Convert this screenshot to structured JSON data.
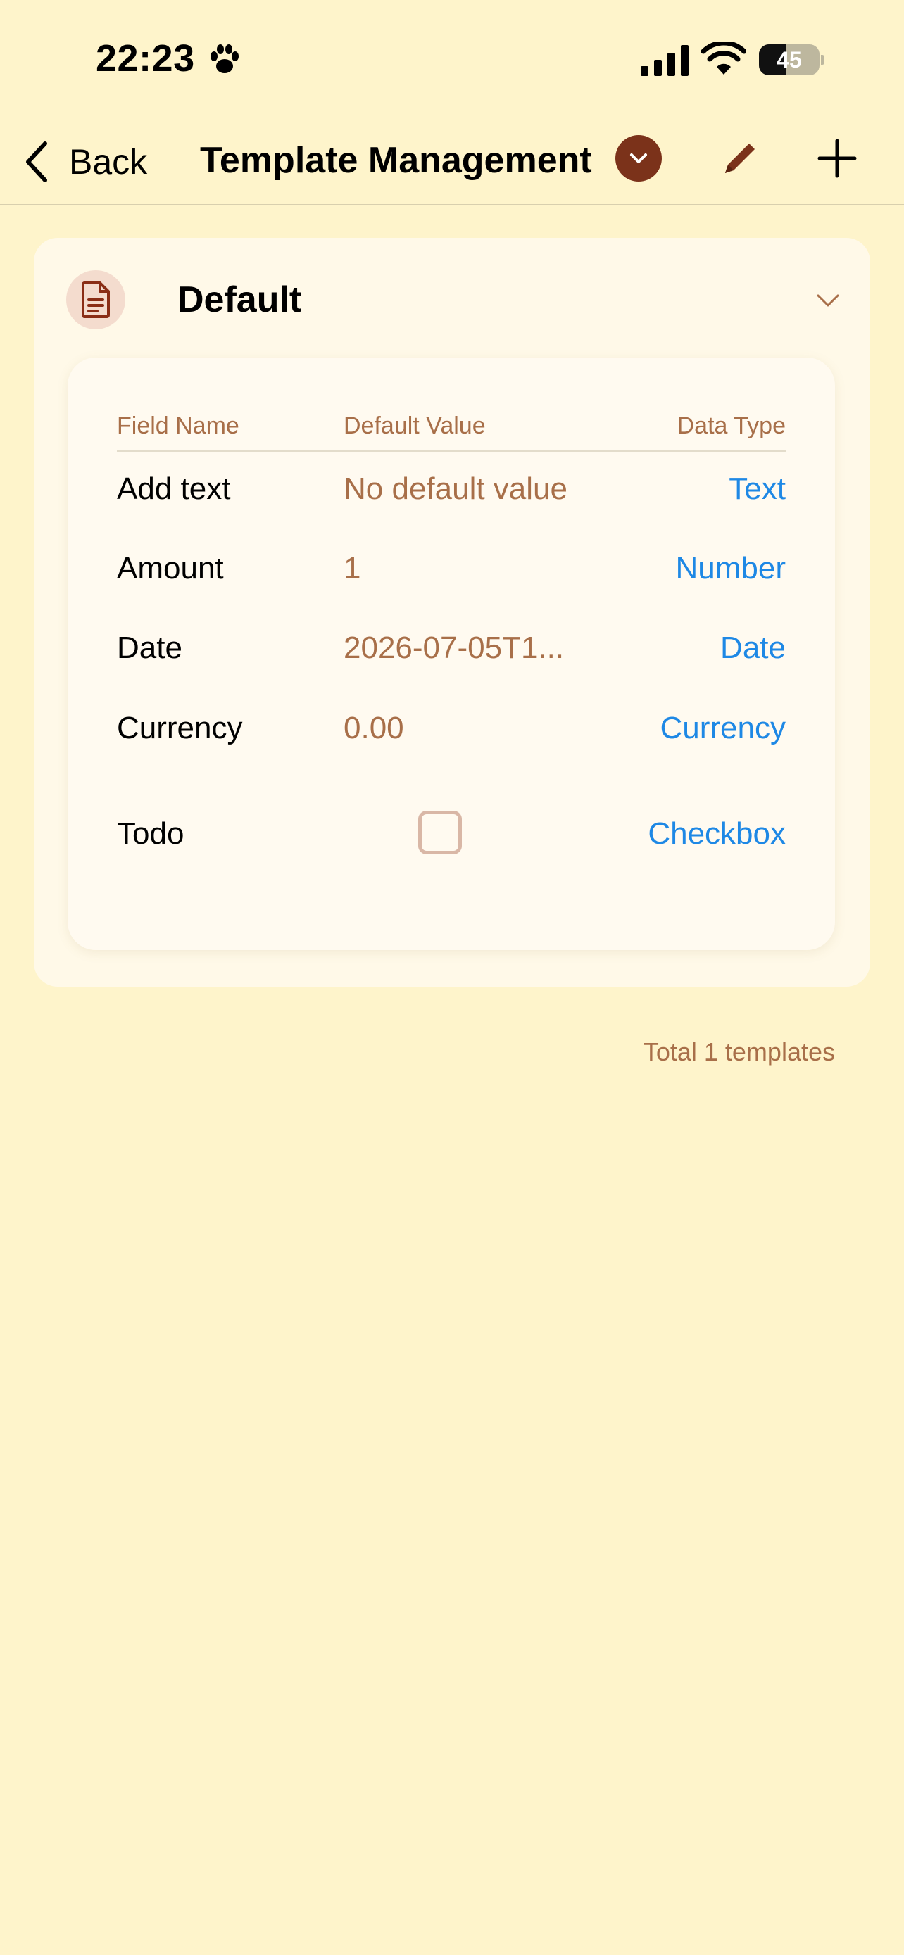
{
  "status_bar": {
    "time": "22:23",
    "battery_level": "45",
    "icons": [
      "paw-icon",
      "signal-icon",
      "wifi-icon",
      "battery-icon"
    ]
  },
  "nav": {
    "back_label": "Back",
    "title": "Template Management",
    "icons": [
      "chevron-left-icon",
      "chevron-down-icon",
      "pencil-icon",
      "plus-icon"
    ]
  },
  "colors": {
    "background": "#FEF4CB",
    "accent_brown": "#7B321A",
    "muted_brown": "#A86F49",
    "link_blue": "#1E88E5"
  },
  "template": {
    "name": "Default",
    "table": {
      "headers": {
        "field_name": "Field Name",
        "default_value": "Default Value",
        "data_type": "Data Type"
      },
      "rows": [
        {
          "name": "Add text",
          "value": "No default value",
          "type": "Text"
        },
        {
          "name": "Amount",
          "value": "1",
          "type": "Number"
        },
        {
          "name": "Date",
          "value": "2026-07-05T1...",
          "type": "Date"
        },
        {
          "name": "Currency",
          "value": "0.00",
          "type": "Currency"
        },
        {
          "name": "Todo",
          "value": "",
          "checked": false,
          "type": "Checkbox"
        }
      ]
    }
  },
  "footer": {
    "total": "Total 1 templates"
  }
}
